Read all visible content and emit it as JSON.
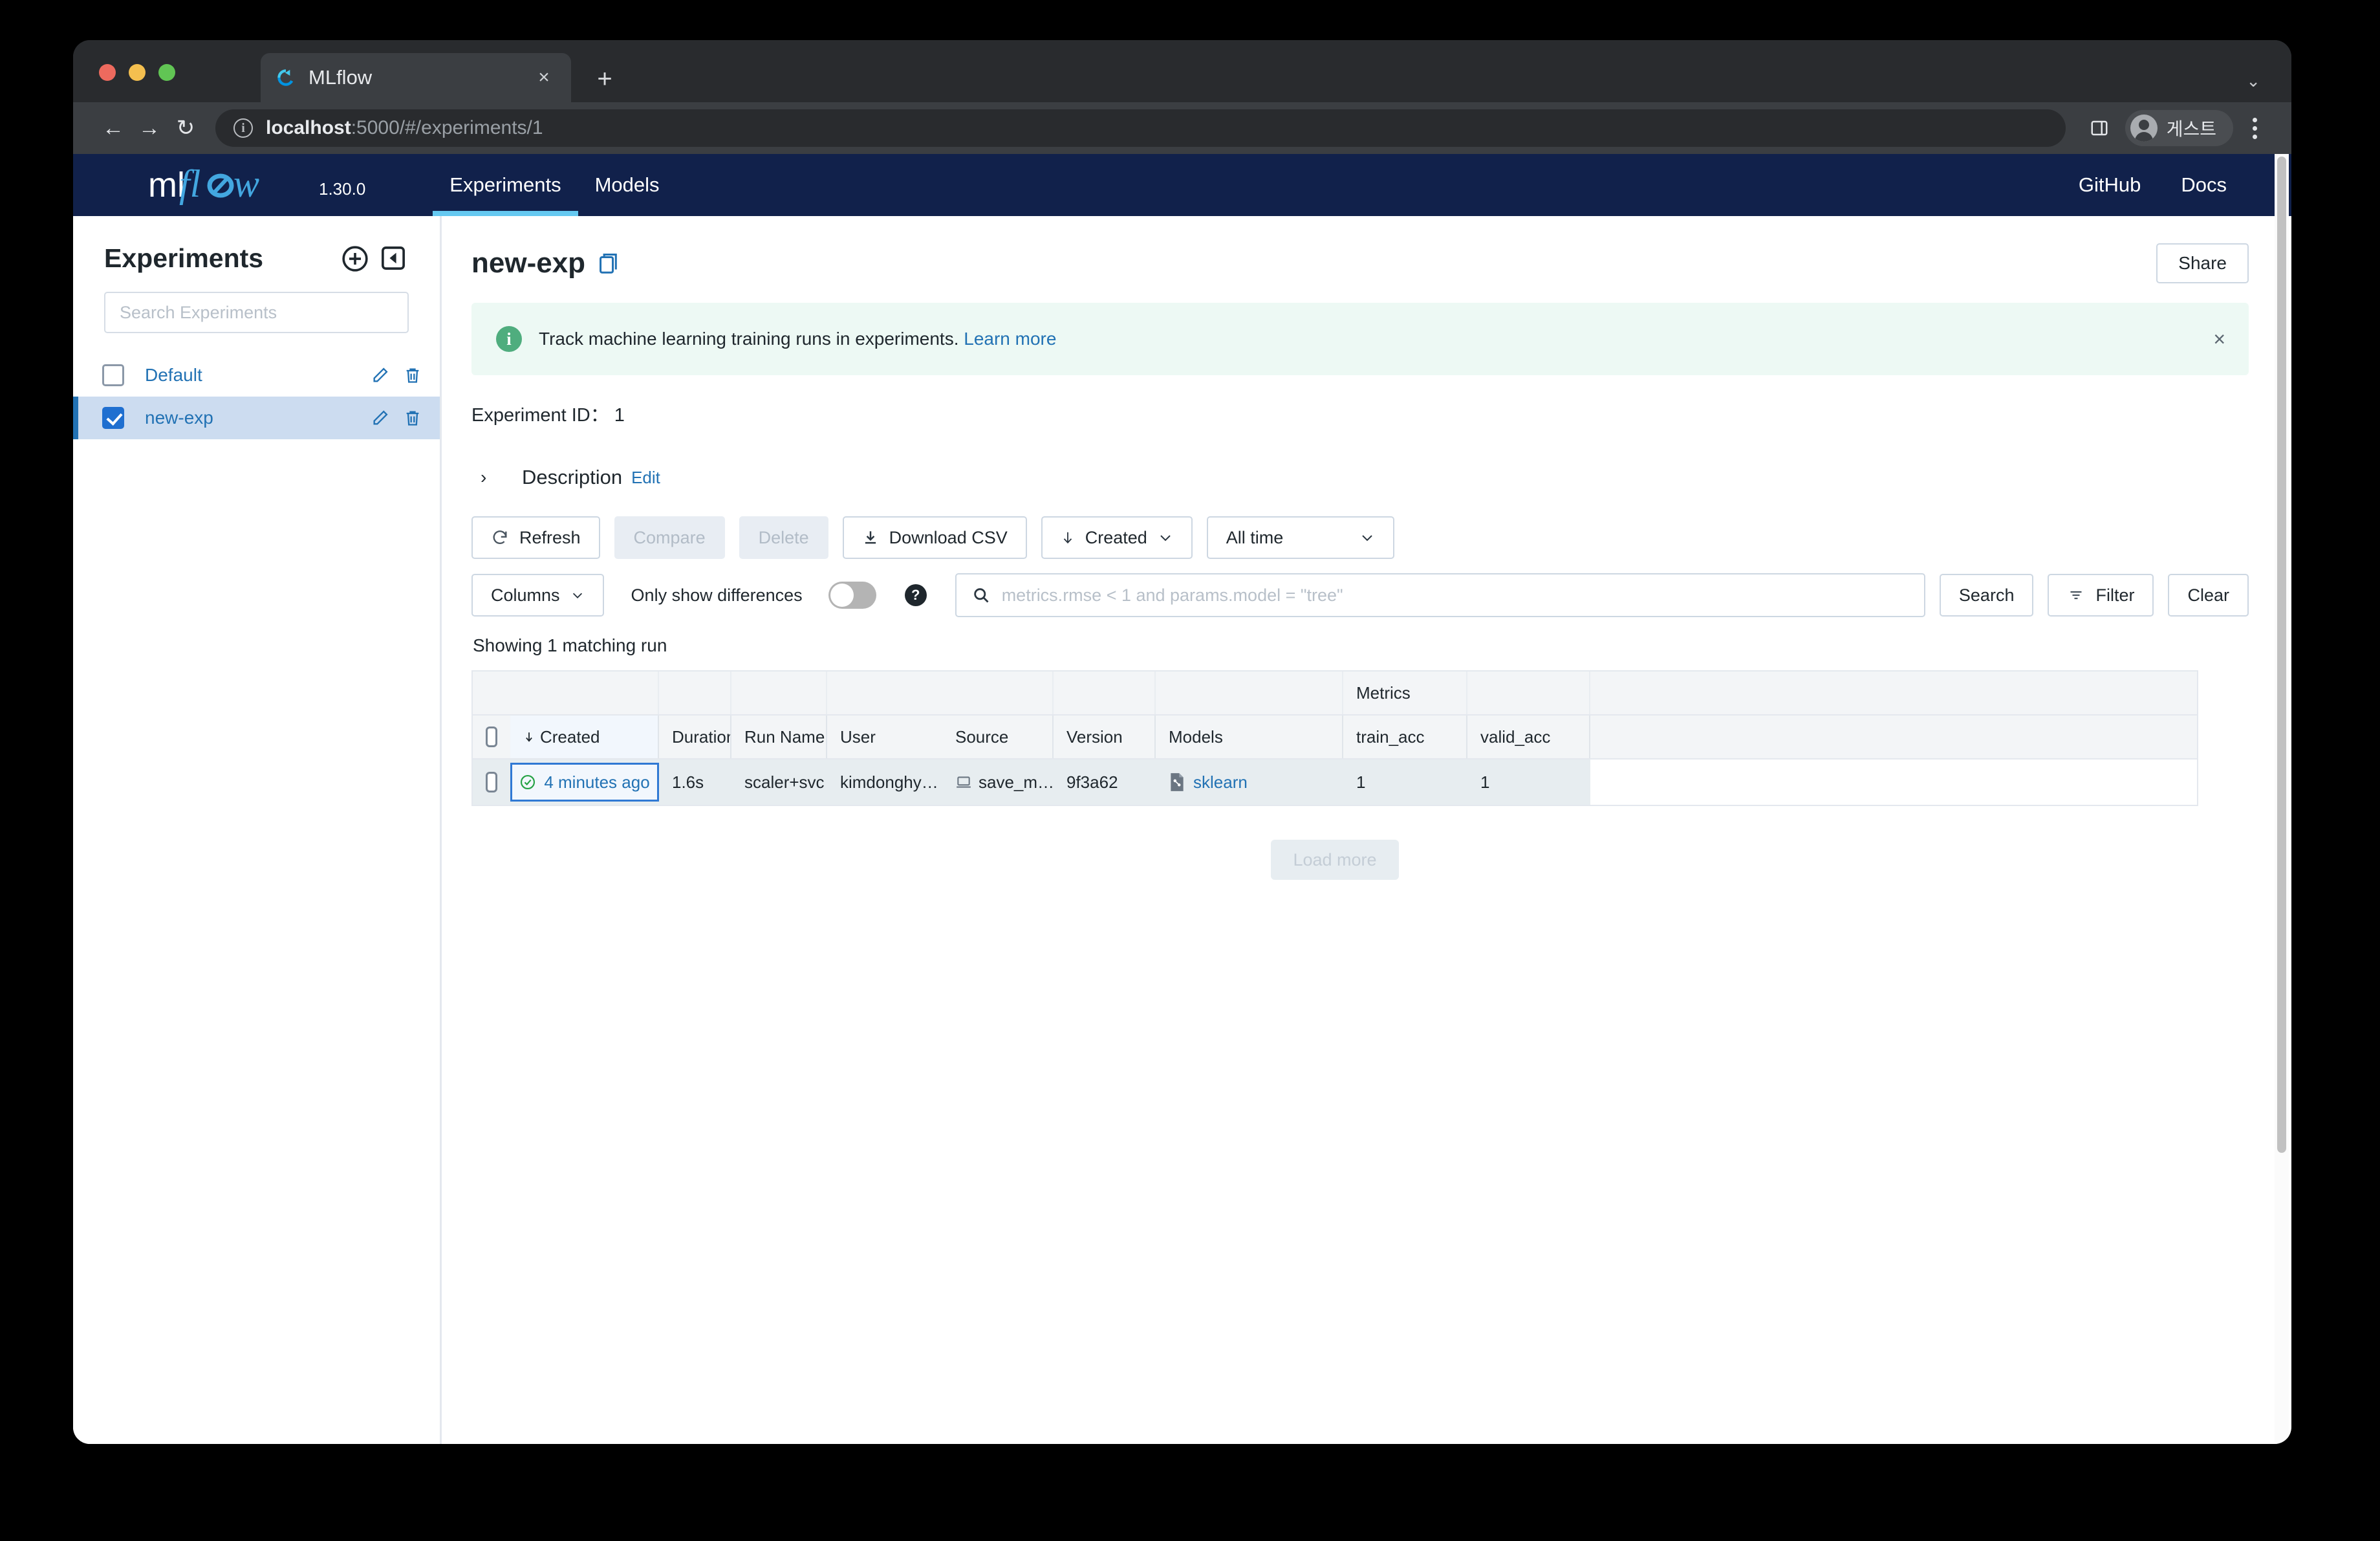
{
  "browser": {
    "tab": {
      "title": "MLflow",
      "favicon": "mlflow-favicon",
      "close_label": "×"
    },
    "new_tab_label": "+",
    "tabstrip_chevron": "⌄",
    "nav": {
      "back": "←",
      "forward": "→",
      "reload": "↻"
    },
    "omnibox": {
      "info_glyph": "i",
      "url_host": "localhost",
      "url_rest": ":5000/#/experiments/1"
    },
    "profile": {
      "name": "게스트",
      "avatar": "person-icon"
    },
    "sidepanel_icon": "side-panel-icon",
    "menu_icon": "kebab-menu-icon"
  },
  "mlflow_header": {
    "logo": "mlflow-logo",
    "version": "1.30.0",
    "nav": [
      {
        "label": "Experiments",
        "active": true
      },
      {
        "label": "Models",
        "active": false
      }
    ],
    "links": [
      {
        "label": "GitHub"
      },
      {
        "label": "Docs"
      }
    ],
    "accent_color": "#65c9f1",
    "background_color": "#11214b"
  },
  "sidebar": {
    "title": "Experiments",
    "add_icon": "plus-circle-icon",
    "collapse_icon": "collapse-panel-icon",
    "search_placeholder": "Search Experiments",
    "search_value": "",
    "items": [
      {
        "name": "Default",
        "checked": false,
        "selected": false,
        "edit_icon": "pencil-icon",
        "delete_icon": "trash-icon"
      },
      {
        "name": "new-exp",
        "checked": true,
        "selected": true,
        "edit_icon": "pencil-icon",
        "delete_icon": "trash-icon"
      }
    ]
  },
  "main": {
    "experiment_name": "new-exp",
    "copy_icon": "copy-icon",
    "share_label": "Share",
    "banner": {
      "icon": "info-circle-icon",
      "text": "Track machine learning training runs in experiments.",
      "link_label": "Learn more",
      "close_label": "×",
      "background_color": "#edf9f4",
      "icon_color": "#4fad7e"
    },
    "experiment_id_label": "Experiment ID：",
    "experiment_id_value": "1",
    "description": {
      "caret": "›",
      "label": "Description",
      "edit_label": "Edit"
    },
    "toolbar_primary": [
      {
        "label": "Refresh",
        "icon": "refresh-icon",
        "disabled": false
      },
      {
        "label": "Compare",
        "icon": "",
        "disabled": true
      },
      {
        "label": "Delete",
        "icon": "",
        "disabled": true
      },
      {
        "label": "Download CSV",
        "icon": "download-icon",
        "disabled": false
      }
    ],
    "sort_button": {
      "label": "Created",
      "prefix_icon": "arrow-down-icon",
      "chevron": "chevron-down-icon"
    },
    "time_filter": {
      "label": "All time",
      "chevron": "chevron-down-icon"
    },
    "columns_button": {
      "label": "Columns",
      "chevron": "chevron-down-icon"
    },
    "only_show_differences": {
      "label": "Only show differences",
      "enabled": false
    },
    "help_icon": "question-mark-icon",
    "search": {
      "icon": "search-icon",
      "placeholder": "metrics.rmse < 1 and params.model = \"tree\"",
      "value": ""
    },
    "search_button": "Search",
    "filter_button": {
      "label": "Filter",
      "icon": "filter-icon"
    },
    "clear_button": "Clear",
    "showing_text": "Showing 1 matching run",
    "load_more_label": "Load more"
  },
  "runs_table": {
    "group_headers": [
      {
        "label": "",
        "key": "blank1"
      },
      {
        "label": "Metrics",
        "key": "metrics"
      }
    ],
    "columns": [
      {
        "key": "created",
        "label": "Created",
        "sort_icon": "arrow-down-icon",
        "sorted": true
      },
      {
        "key": "duration",
        "label": "Duration"
      },
      {
        "key": "run_name",
        "label": "Run Name"
      },
      {
        "key": "user",
        "label": "User"
      },
      {
        "key": "source",
        "label": "Source"
      },
      {
        "key": "version",
        "label": "Version"
      },
      {
        "key": "models",
        "label": "Models"
      },
      {
        "key": "train_acc",
        "label": "train_acc"
      },
      {
        "key": "valid_acc",
        "label": "valid_acc"
      }
    ],
    "rows": [
      {
        "selected": false,
        "status_icon": "check-circle-icon",
        "created": "4 minutes ago",
        "duration": "1.6s",
        "run_name": "scaler+svc",
        "user": "kimdonghy…",
        "source_icon": "laptop-icon",
        "source": "save_m…",
        "version": "9f3a62",
        "models_icon": "sklearn-icon",
        "models": "sklearn",
        "train_acc": "1",
        "valid_acc": "1"
      }
    ]
  }
}
